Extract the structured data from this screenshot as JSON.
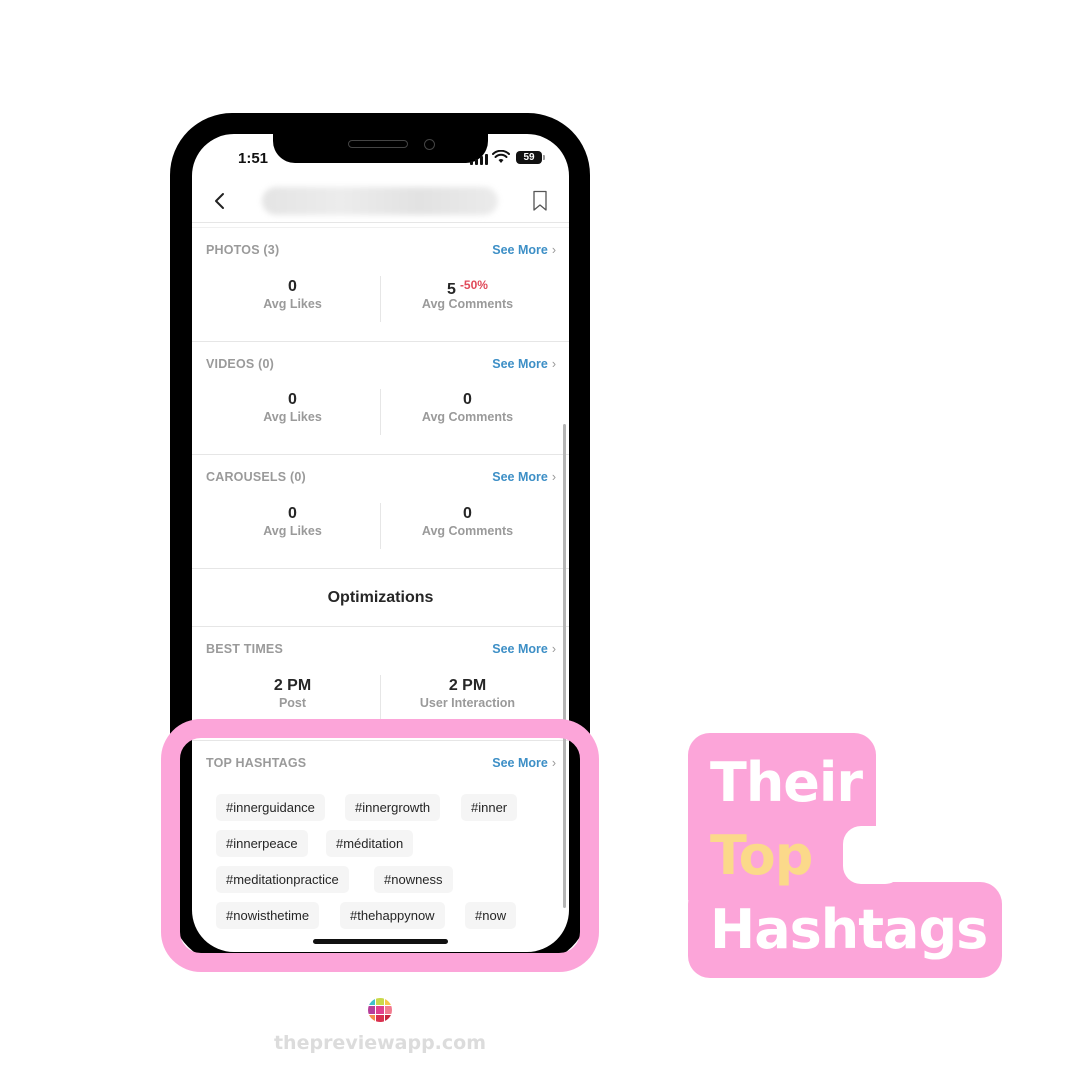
{
  "status_bar": {
    "time": "1:51",
    "battery": "59"
  },
  "nav": {
    "back_icon": "chevron-left-icon",
    "title_blurred": true,
    "bookmark_icon": "bookmark-icon"
  },
  "sections": [
    {
      "title": "PHOTOS (3)",
      "see_more": "See More",
      "left": {
        "value": "0",
        "label": "Avg Likes"
      },
      "right": {
        "value": "5",
        "delta": "-50%",
        "label": "Avg Comments"
      }
    },
    {
      "title": "VIDEOS (0)",
      "see_more": "See More",
      "left": {
        "value": "0",
        "label": "Avg Likes"
      },
      "right": {
        "value": "0",
        "label": "Avg Comments"
      }
    },
    {
      "title": "CAROUSELS (0)",
      "see_more": "See More",
      "left": {
        "value": "0",
        "label": "Avg Likes"
      },
      "right": {
        "value": "0",
        "label": "Avg Comments"
      }
    }
  ],
  "optimizations": {
    "title": "Optimizations",
    "best_times": {
      "title": "BEST TIMES",
      "see_more": "See More",
      "left": {
        "value": "2 PM",
        "label": "Post"
      },
      "right": {
        "value": "2 PM",
        "label": "User Interaction"
      }
    },
    "top_hashtags": {
      "title": "TOP HASHTAGS",
      "see_more": "See More",
      "tags": [
        "#innerguidance",
        "#innergrowth",
        "#inner",
        "#innerpeace",
        "#méditation",
        "#meditationpractice",
        "#nowness",
        "#nowisthetime",
        "#thehappynow",
        "#now"
      ]
    }
  },
  "chevron_glyph": "›",
  "overlay_label": {
    "line1": "Their",
    "line2": "Top",
    "line3": "Hashtags"
  },
  "colors": {
    "highlight_pink": "#fca5d9",
    "accent_yellow": "#fbd98a",
    "link_blue": "#3d8fc6",
    "negative_red": "#e04a5a"
  },
  "brand": {
    "text": "thepreviewapp.com"
  }
}
